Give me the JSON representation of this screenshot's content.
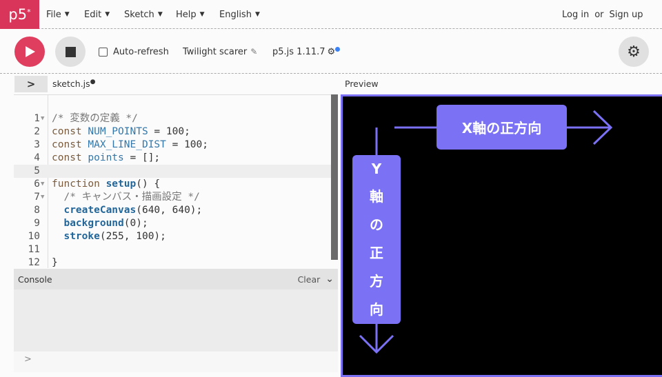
{
  "nav": {
    "logo": "p5",
    "logo_sup": "*",
    "menus": [
      "File",
      "Edit",
      "Sketch",
      "Help",
      "English"
    ],
    "login": "Log in",
    "or": "or",
    "signup": "Sign up"
  },
  "toolbar": {
    "auto_refresh": "Auto-refresh",
    "sketch_name": "Twilight scarer",
    "version": "p5.js 1.11.7"
  },
  "editor": {
    "tab": "sketch.js",
    "lines": [
      {
        "n": "1",
        "fold": true,
        "tokens": [
          {
            "k": "cm",
            "t": "/* 変数の定義 */"
          }
        ]
      },
      {
        "n": "2",
        "tokens": [
          {
            "k": "kw",
            "t": "const "
          },
          {
            "k": "var",
            "t": "NUM_POINTS"
          },
          {
            "k": "p",
            "t": " = 100;"
          }
        ]
      },
      {
        "n": "3",
        "tokens": [
          {
            "k": "kw",
            "t": "const "
          },
          {
            "k": "var",
            "t": "MAX_LINE_DIST"
          },
          {
            "k": "p",
            "t": " = 100;"
          }
        ]
      },
      {
        "n": "4",
        "tokens": [
          {
            "k": "kw",
            "t": "const "
          },
          {
            "k": "var",
            "t": "points"
          },
          {
            "k": "p",
            "t": " = [];"
          }
        ]
      },
      {
        "n": "5",
        "active": true,
        "tokens": []
      },
      {
        "n": "6",
        "fold": true,
        "tokens": [
          {
            "k": "kw",
            "t": "function "
          },
          {
            "k": "fn",
            "t": "setup"
          },
          {
            "k": "p",
            "t": "() {"
          }
        ]
      },
      {
        "n": "7",
        "fold": true,
        "tokens": [
          {
            "k": "cm",
            "t": "  /* キャンバス・描画設定 */"
          }
        ]
      },
      {
        "n": "8",
        "tokens": [
          {
            "k": "p",
            "t": "  "
          },
          {
            "k": "fn",
            "t": "createCanvas"
          },
          {
            "k": "p",
            "t": "(640, 640);"
          }
        ]
      },
      {
        "n": "9",
        "tokens": [
          {
            "k": "p",
            "t": "  "
          },
          {
            "k": "fn",
            "t": "background"
          },
          {
            "k": "p",
            "t": "(0);"
          }
        ]
      },
      {
        "n": "10",
        "tokens": [
          {
            "k": "p",
            "t": "  "
          },
          {
            "k": "fn",
            "t": "stroke"
          },
          {
            "k": "p",
            "t": "(255, 100);"
          }
        ]
      },
      {
        "n": "11",
        "tokens": []
      },
      {
        "n": "12",
        "tokens": [
          {
            "k": "p",
            "t": "}"
          }
        ]
      }
    ]
  },
  "console": {
    "title": "Console",
    "clear": "Clear",
    "prompt": ">"
  },
  "preview": {
    "title": "Preview",
    "x_label": "X軸の正方向",
    "y_label": [
      "Y",
      "軸",
      "の",
      "正",
      "方",
      "向"
    ]
  },
  "colors": {
    "brand": "#d9345a",
    "annotation": "#7b71f5"
  }
}
